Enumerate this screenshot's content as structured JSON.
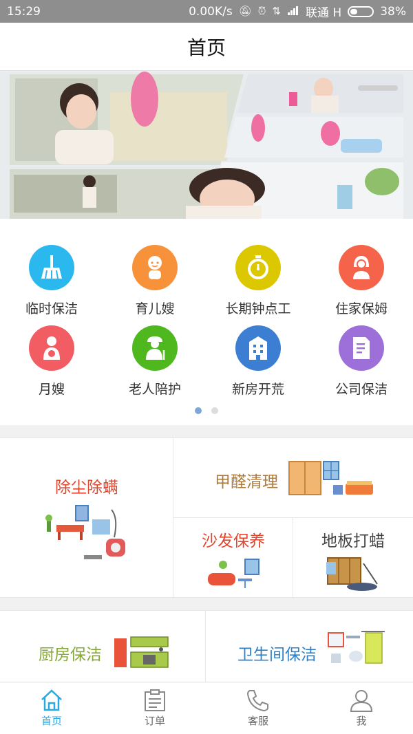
{
  "status_bar": {
    "time": "15:29",
    "network_speed": "0.00K/s",
    "carrier": "联通 H",
    "battery": "38%",
    "icons": [
      "mute-icon",
      "alarm-icon",
      "data-arrows-icon",
      "signal-icon",
      "battery-icon"
    ]
  },
  "header": {
    "title": "首页"
  },
  "categories": [
    {
      "label": "临时保洁",
      "color": "#2bb8ef",
      "icon": "broom-icon"
    },
    {
      "label": "育儿嫂",
      "color": "#f7923a",
      "icon": "baby-icon"
    },
    {
      "label": "长期钟点工",
      "color": "#dcc800",
      "icon": "stopwatch-icon"
    },
    {
      "label": "住家保姆",
      "color": "#f4634a",
      "icon": "nanny-icon"
    },
    {
      "label": "月嫂",
      "color": "#f25c63",
      "icon": "mother-baby-icon"
    },
    {
      "label": "老人陪护",
      "color": "#4fb81f",
      "icon": "elderly-icon"
    },
    {
      "label": "新房开荒",
      "color": "#3c7fd2",
      "icon": "building-icon"
    },
    {
      "label": "公司保洁",
      "color": "#9d6fd8",
      "icon": "document-icon"
    }
  ],
  "pager": {
    "pages": 2,
    "active": 1
  },
  "services": {
    "dust_mites": {
      "label": "除尘除螨",
      "color": "#e0462e"
    },
    "formaldehyde": {
      "label": "甲醛清理",
      "color": "#b07a3a"
    },
    "sofa": {
      "label": "沙发保养",
      "color": "#e0462e"
    },
    "floor_wax": {
      "label": "地板打蜡",
      "color": "#444444"
    },
    "kitchen": {
      "label": "厨房保洁",
      "color": "#86a93a"
    },
    "bathroom": {
      "label": "卫生间保洁",
      "color": "#2f82c8"
    }
  },
  "tabbar": {
    "items": [
      {
        "label": "首页",
        "icon": "home-icon",
        "active": true
      },
      {
        "label": "订单",
        "icon": "clipboard-icon",
        "active": false
      },
      {
        "label": "客服",
        "icon": "phone-icon",
        "active": false
      },
      {
        "label": "我",
        "icon": "user-icon",
        "active": false
      }
    ],
    "active_color": "#29a9e0"
  }
}
